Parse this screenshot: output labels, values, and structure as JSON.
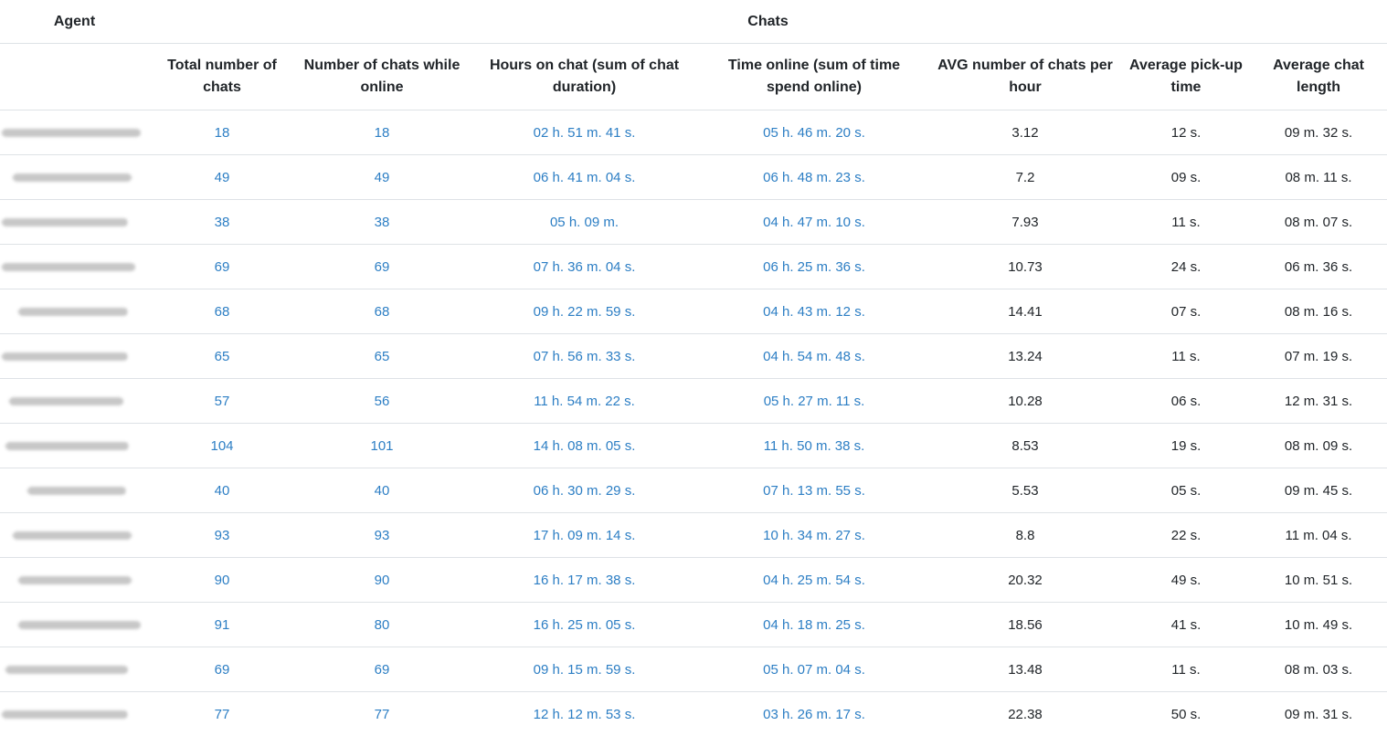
{
  "table": {
    "group_headers": {
      "agent": "Agent",
      "chats": "Chats"
    },
    "columns": [
      "Total number of chats",
      "Number of chats while online",
      "Hours on chat (sum of chat duration)",
      "Time online (sum of time spend online)",
      "AVG number of chats per hour",
      "Average pick-up time",
      "Average chat length"
    ],
    "agents_redacted": true,
    "rows": [
      {
        "total": "18",
        "online": "18",
        "hours": "02 h. 51 m. 41 s.",
        "time_online": "05 h. 46 m. 20 s.",
        "avg_per_hour": "3.12",
        "pickup": "12 s.",
        "length": "09 m. 32 s."
      },
      {
        "total": "49",
        "online": "49",
        "hours": "06 h. 41 m. 04 s.",
        "time_online": "06 h. 48 m. 23 s.",
        "avg_per_hour": "7.2",
        "pickup": "09 s.",
        "length": "08 m. 11 s."
      },
      {
        "total": "38",
        "online": "38",
        "hours": "05 h. 09 m.",
        "time_online": "04 h. 47 m. 10 s.",
        "avg_per_hour": "7.93",
        "pickup": "11 s.",
        "length": "08 m. 07 s."
      },
      {
        "total": "69",
        "online": "69",
        "hours": "07 h. 36 m. 04 s.",
        "time_online": "06 h. 25 m. 36 s.",
        "avg_per_hour": "10.73",
        "pickup": "24 s.",
        "length": "06 m. 36 s."
      },
      {
        "total": "68",
        "online": "68",
        "hours": "09 h. 22 m. 59 s.",
        "time_online": "04 h. 43 m. 12 s.",
        "avg_per_hour": "14.41",
        "pickup": "07 s.",
        "length": "08 m. 16 s."
      },
      {
        "total": "65",
        "online": "65",
        "hours": "07 h. 56 m. 33 s.",
        "time_online": "04 h. 54 m. 48 s.",
        "avg_per_hour": "13.24",
        "pickup": "11 s.",
        "length": "07 m. 19 s."
      },
      {
        "total": "57",
        "online": "56",
        "hours": "11 h. 54 m. 22 s.",
        "time_online": "05 h. 27 m. 11 s.",
        "avg_per_hour": "10.28",
        "pickup": "06 s.",
        "length": "12 m. 31 s."
      },
      {
        "total": "104",
        "online": "101",
        "hours": "14 h. 08 m. 05 s.",
        "time_online": "11 h. 50 m. 38 s.",
        "avg_per_hour": "8.53",
        "pickup": "19 s.",
        "length": "08 m. 09 s."
      },
      {
        "total": "40",
        "online": "40",
        "hours": "06 h. 30 m. 29 s.",
        "time_online": "07 h. 13 m. 55 s.",
        "avg_per_hour": "5.53",
        "pickup": "05 s.",
        "length": "09 m. 45 s."
      },
      {
        "total": "93",
        "online": "93",
        "hours": "17 h. 09 m. 14 s.",
        "time_online": "10 h. 34 m. 27 s.",
        "avg_per_hour": "8.8",
        "pickup": "22 s.",
        "length": "11 m. 04 s."
      },
      {
        "total": "90",
        "online": "90",
        "hours": "16 h. 17 m. 38 s.",
        "time_online": "04 h. 25 m. 54 s.",
        "avg_per_hour": "20.32",
        "pickup": "49 s.",
        "length": "10 m. 51 s."
      },
      {
        "total": "91",
        "online": "80",
        "hours": "16 h. 25 m. 05 s.",
        "time_online": "04 h. 18 m. 25 s.",
        "avg_per_hour": "18.56",
        "pickup": "41 s.",
        "length": "10 m. 49 s."
      },
      {
        "total": "69",
        "online": "69",
        "hours": "09 h. 15 m. 59 s.",
        "time_online": "05 h. 07 m. 04 s.",
        "avg_per_hour": "13.48",
        "pickup": "11 s.",
        "length": "08 m. 03 s."
      },
      {
        "total": "77",
        "online": "77",
        "hours": "12 h. 12 m. 53 s.",
        "time_online": "03 h. 26 m. 17 s.",
        "avg_per_hour": "22.38",
        "pickup": "50 s.",
        "length": "09 m. 31 s."
      }
    ],
    "colors": {
      "link": "#2c7ec4",
      "text": "#212529",
      "border": "#dee2e6"
    }
  }
}
